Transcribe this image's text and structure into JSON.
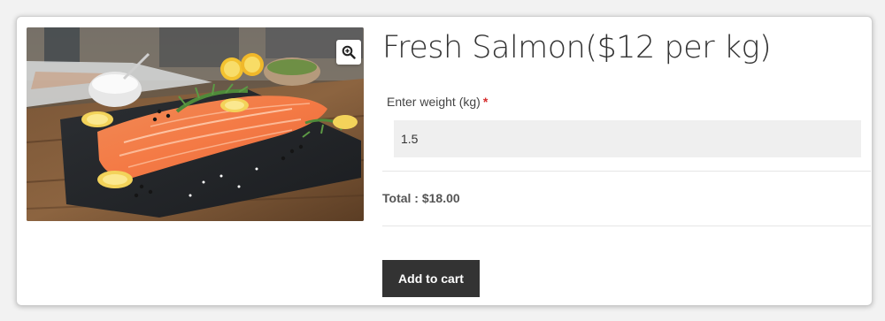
{
  "product": {
    "title": "Fresh Salmon($12 per kg)",
    "image_icon": "product-photo-salmon",
    "zoom_icon": "zoom-in-icon"
  },
  "form": {
    "weight_label": "Enter weight (kg)",
    "required_marker": "*",
    "weight_value": "1.5",
    "total_label": "Total : $18.00",
    "add_to_cart_label": "Add to cart"
  },
  "colors": {
    "button_bg": "#333333",
    "required_star": "#d62d2d",
    "input_bg": "#efefef"
  }
}
